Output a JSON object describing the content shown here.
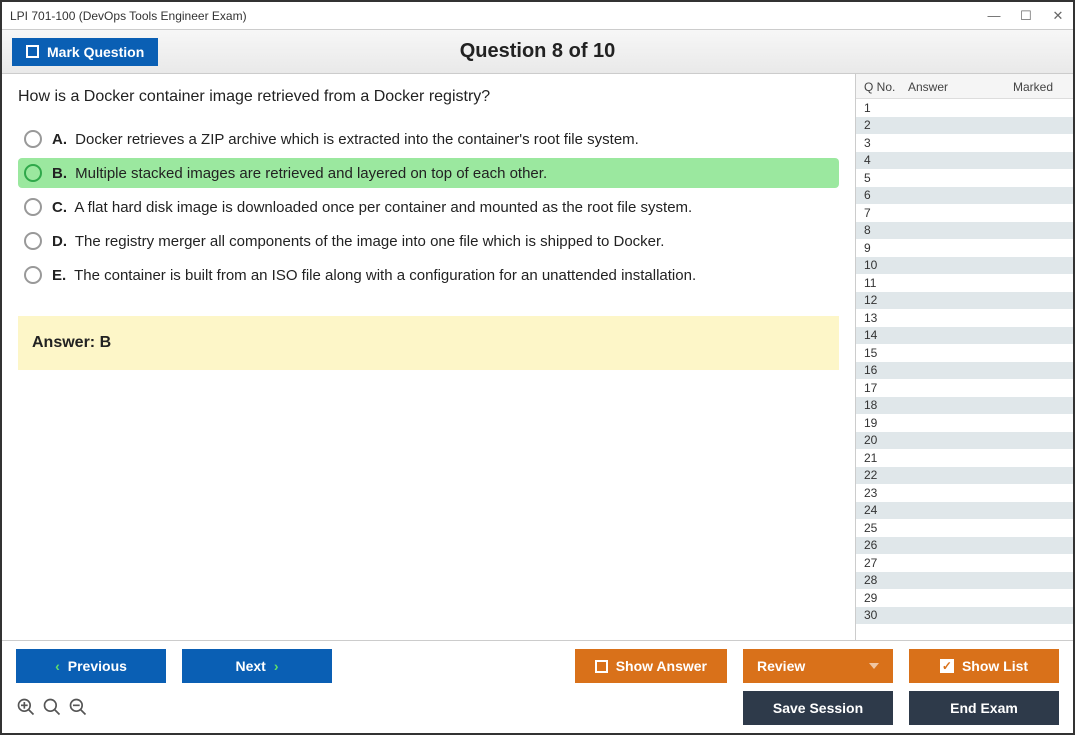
{
  "window": {
    "title": "LPI 701-100 (DevOps Tools Engineer Exam)"
  },
  "topbar": {
    "mark_label": "Mark Question",
    "question_title": "Question 8 of 10"
  },
  "question": {
    "text": "How is a Docker container image retrieved from a Docker registry?",
    "options": [
      {
        "letter": "A.",
        "text": "Docker retrieves a ZIP archive which is extracted into the container's root file system.",
        "correct": false
      },
      {
        "letter": "B.",
        "text": "Multiple stacked images are retrieved and layered on top of each other.",
        "correct": true
      },
      {
        "letter": "C.",
        "text": "A flat hard disk image is downloaded once per container and mounted as the root file system.",
        "correct": false
      },
      {
        "letter": "D.",
        "text": "The registry merger all components of the image into one file which is shipped to Docker.",
        "correct": false
      },
      {
        "letter": "E.",
        "text": "The container is built from an ISO file along with a configuration for an unattended installation.",
        "correct": false
      }
    ],
    "answer_label": "Answer: B"
  },
  "sidebar": {
    "headers": {
      "qno": "Q No.",
      "answer": "Answer",
      "marked": "Marked"
    },
    "rows": [
      1,
      2,
      3,
      4,
      5,
      6,
      7,
      8,
      9,
      10,
      11,
      12,
      13,
      14,
      15,
      16,
      17,
      18,
      19,
      20,
      21,
      22,
      23,
      24,
      25,
      26,
      27,
      28,
      29,
      30
    ]
  },
  "buttons": {
    "previous": "Previous",
    "next": "Next",
    "show_answer": "Show Answer",
    "review": "Review",
    "show_list": "Show List",
    "save_session": "Save Session",
    "end_exam": "End Exam"
  }
}
